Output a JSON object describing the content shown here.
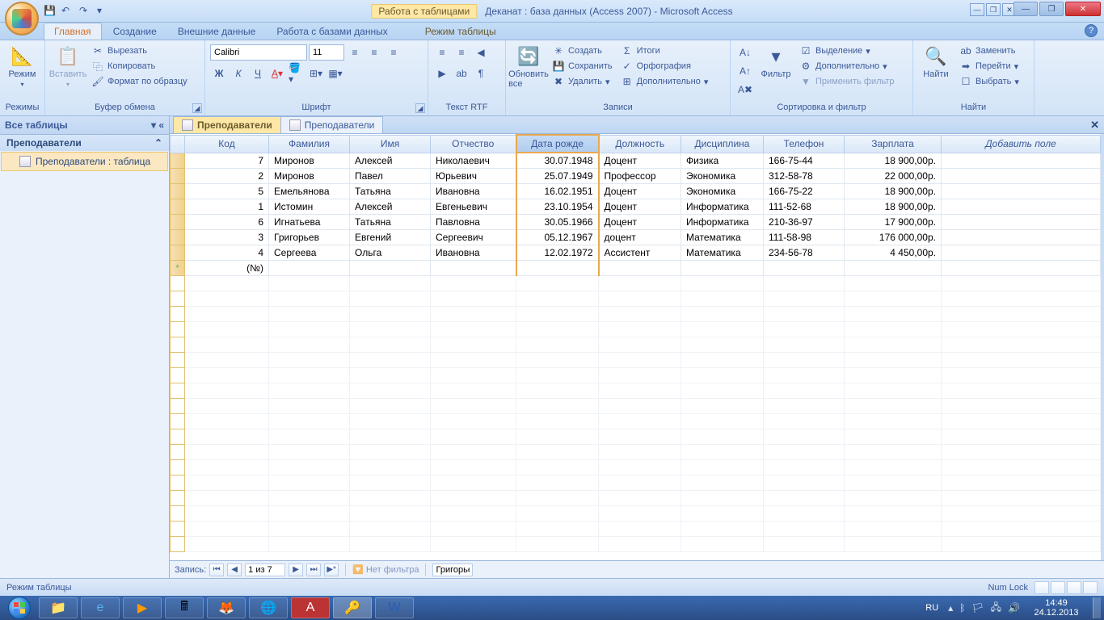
{
  "titlebar": {
    "tools_label": "Работа с таблицами",
    "title": "Деканат : база данных (Access 2007) - Microsoft Access"
  },
  "tabs": {
    "home": "Главная",
    "create": "Создание",
    "external": "Внешние данные",
    "dbtools": "Работа с базами данных",
    "datasheet": "Режим таблицы"
  },
  "ribbon": {
    "views": {
      "label": "Режимы",
      "btn": "Режим"
    },
    "clipboard": {
      "label": "Буфер обмена",
      "paste": "Вставить",
      "cut": "Вырезать",
      "copy": "Копировать",
      "format_painter": "Формат по образцу"
    },
    "font": {
      "label": "Шрифт",
      "family": "Calibri",
      "size": "11"
    },
    "richtext": {
      "label": "Текст RTF"
    },
    "records": {
      "label": "Записи",
      "refresh": "Обновить все",
      "new": "Создать",
      "save": "Сохранить",
      "delete": "Удалить",
      "totals": "Итоги",
      "spelling": "Орфография",
      "more": "Дополнительно"
    },
    "sortfilter": {
      "label": "Сортировка и фильтр",
      "filter": "Фильтр",
      "selection": "Выделение",
      "advanced": "Дополнительно",
      "toggle": "Применить фильтр"
    },
    "find": {
      "label": "Найти",
      "find_btn": "Найти",
      "replace": "Заменить",
      "goto": "Перейти",
      "select": "Выбрать"
    }
  },
  "navpane": {
    "header": "Все таблицы",
    "category": "Преподаватели",
    "item": "Преподаватели : таблица"
  },
  "doc_tabs": {
    "tab1": "Преподаватели",
    "tab2": "Преподаватели"
  },
  "columns": {
    "code": "Код",
    "surname": "Фамилия",
    "name": "Имя",
    "patronymic": "Отчество",
    "dob": "Дата рожде",
    "position": "Должность",
    "discipline": "Дисциплина",
    "phone": "Телефон",
    "salary": "Зарплата",
    "addfield": "Добавить поле"
  },
  "rows": [
    {
      "code": "7",
      "surname": "Миронов",
      "name": "Алексей",
      "patronymic": "Николаевич",
      "dob": "30.07.1948",
      "position": "Доцент",
      "discipline": "Физика",
      "phone": "166-75-44",
      "salary": "18 900,00р."
    },
    {
      "code": "2",
      "surname": "Миронов",
      "name": "Павел",
      "patronymic": "Юрьевич",
      "dob": "25.07.1949",
      "position": "Профессор",
      "discipline": "Экономика",
      "phone": "312-58-78",
      "salary": "22 000,00р."
    },
    {
      "code": "5",
      "surname": "Емельянова",
      "name": "Татьяна",
      "patronymic": "Ивановна",
      "dob": "16.02.1951",
      "position": "Доцент",
      "discipline": "Экономика",
      "phone": "166-75-22",
      "salary": "18 900,00р."
    },
    {
      "code": "1",
      "surname": "Истомин",
      "name": "Алексей",
      "patronymic": "Евгеньевич",
      "dob": "23.10.1954",
      "position": "Доцент",
      "discipline": "Информатика",
      "phone": "111-52-68",
      "salary": "18 900,00р."
    },
    {
      "code": "6",
      "surname": "Игнатьева",
      "name": "Татьяна",
      "patronymic": "Павловна",
      "dob": "30.05.1966",
      "position": "Доцент",
      "discipline": "Информатика",
      "phone": "210-36-97",
      "salary": "17 900,00р."
    },
    {
      "code": "3",
      "surname": "Григорьев",
      "name": "Евгений",
      "patronymic": "Сергеевич",
      "dob": "05.12.1967",
      "position": "доцент",
      "discipline": "Математика",
      "phone": "111-58-98",
      "salary": "176 000,00р."
    },
    {
      "code": "4",
      "surname": "Сергеева",
      "name": "Ольга",
      "patronymic": "Ивановна",
      "dob": "12.02.1972",
      "position": "Ассистент",
      "discipline": "Математика",
      "phone": "234-56-78",
      "salary": "4 450,00р."
    }
  ],
  "newrow_code": "(№)",
  "record_nav": {
    "label": "Запись:",
    "position": "1 из 7",
    "nofilter": "Нет фильтра",
    "search": "Григорьев"
  },
  "statusbar": {
    "left": "Режим таблицы",
    "numlock": "Num Lock"
  },
  "tray": {
    "lang": "RU",
    "time": "14:49",
    "date": "24.12.2013"
  }
}
